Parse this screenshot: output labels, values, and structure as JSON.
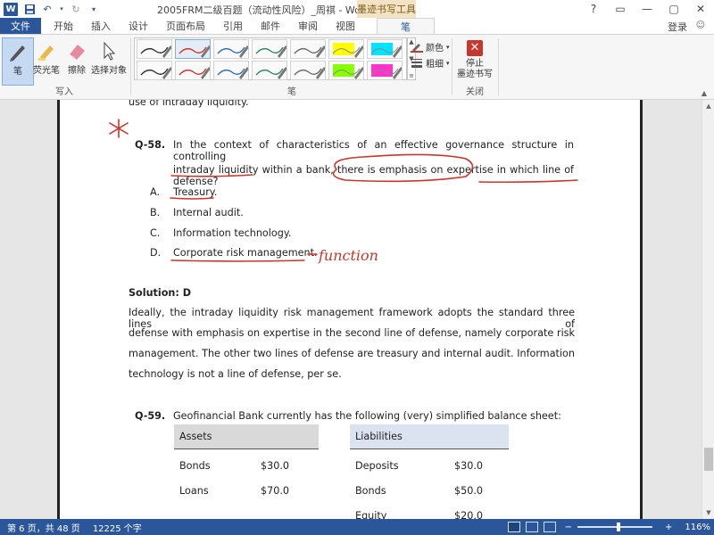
{
  "app": {
    "logo_letter": "W",
    "title": "2005FRM二级百题（流动性风险）_周祺 - Word",
    "context_tab_title": "墨迹书写工具",
    "window_controls": [
      "?",
      "▭",
      "—",
      "▢",
      "✕"
    ],
    "login_label": "登录"
  },
  "tabs": [
    "文件",
    "开始",
    "插入",
    "设计",
    "页面布局",
    "引用",
    "邮件",
    "审阅",
    "视图",
    "笔"
  ],
  "active_tab": "笔",
  "ribbon": {
    "write_group": {
      "label": "写入",
      "pen_label": "笔",
      "highlighter_label": "荧光笔",
      "eraser_label": "擦除",
      "select_label": "选择对象"
    },
    "pens_group": {
      "label": "笔",
      "color_label": "颜色",
      "thickness_label": "粗细",
      "pen_colors": [
        "#333333",
        "#c8372d",
        "#2f6db5",
        "#2e8b57",
        "#6b6b6b",
        "#ffff00",
        "#00e5ff",
        "#333333",
        "#c8372d",
        "#2f6db5",
        "#2e8b57",
        "#6b6b6b",
        "#88ff00",
        "#ff33cc"
      ],
      "highlighter_indices": [
        5,
        6,
        12,
        13
      ],
      "selected_index": 1
    },
    "close_group": {
      "label": "关闭",
      "stop_label_1": "停止",
      "stop_label_2": "墨迹书写"
    }
  },
  "document": {
    "prev_line": "use of intraday liquidity.",
    "q58": {
      "number": "Q-58.",
      "line1": "In the context of characteristics of an effective governance structure in controlling",
      "line2": "intraday liquidity within a bank, there is emphasis on expertise in which line of defense?",
      "options": [
        {
          "letter": "A.",
          "text": "Treasury."
        },
        {
          "letter": "B.",
          "text": "Internal audit."
        },
        {
          "letter": "C.",
          "text": "Information technology."
        },
        {
          "letter": "D.",
          "text": "Corporate risk management."
        }
      ]
    },
    "solution": {
      "heading": "Solution: D",
      "lines": [
        "Ideally, the intraday liquidity risk management framework adopts the standard three lines of",
        "defense with emphasis on expertise in the second line of defense, namely corporate risk",
        "management. The other two lines of defense are treasury and internal audit. Information",
        "technology is not a line of defense, per se."
      ]
    },
    "q59": {
      "number": "Q-59.",
      "text": "Geofinancial Bank currently has the following (very) simplified balance sheet:",
      "assets_header": "Assets",
      "liabilities_header": "Liabilities",
      "assets": [
        {
          "name": "Bonds",
          "value": "$30.0"
        },
        {
          "name": "Loans",
          "value": "$70.0"
        }
      ],
      "liabilities": [
        {
          "name": "Deposits",
          "value": "$30.0"
        },
        {
          "name": "Bonds",
          "value": "$50.0"
        },
        {
          "name": "Equity",
          "value": "$20.0"
        }
      ]
    },
    "handwriting_note": "function"
  },
  "status": {
    "page": "第 6 页，共 48 页",
    "words": "12225 个字",
    "zoom": "116%"
  },
  "colors": {
    "brand": "#2b579a",
    "ink": "#c8372d"
  }
}
